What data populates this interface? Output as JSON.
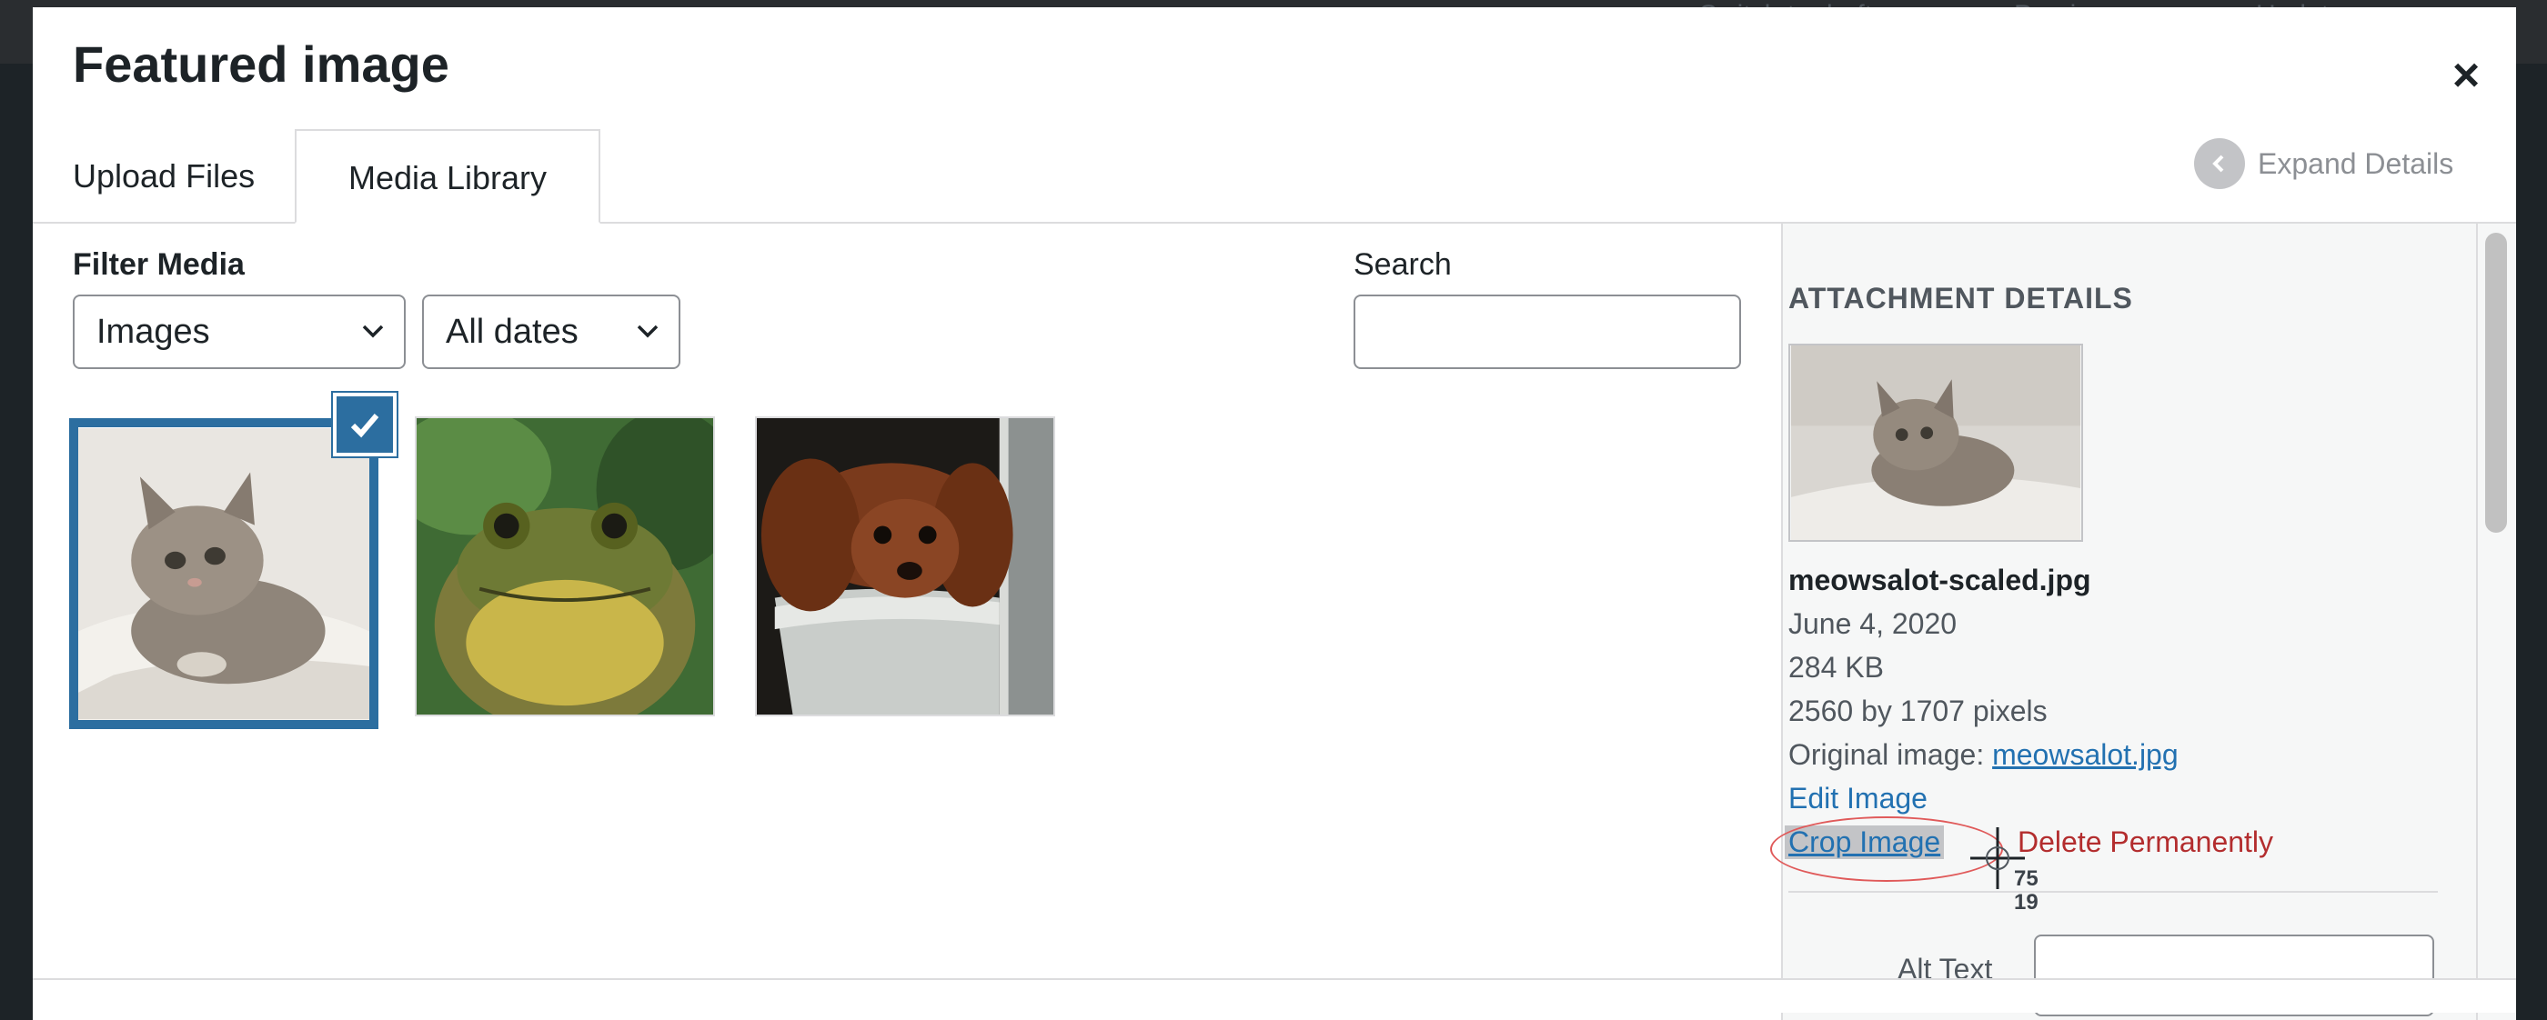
{
  "modal": {
    "title": "Featured image",
    "close_label": "×",
    "tabs": [
      {
        "label": "Upload Files"
      },
      {
        "label": "Media Library",
        "active": true
      }
    ],
    "expand_details": "Expand Details"
  },
  "background_toolbar": {
    "switch_to_draft": "Switch to draft",
    "preview": "Preview",
    "update": "Update"
  },
  "filters": {
    "label": "Filter Media",
    "type_select": {
      "value": "Images"
    },
    "date_select": {
      "value": "All dates"
    },
    "search_label": "Search",
    "search_value": ""
  },
  "media": [
    {
      "subject": "kitten",
      "selected": true
    },
    {
      "subject": "frog",
      "selected": false
    },
    {
      "subject": "dog",
      "selected": false
    }
  ],
  "attachment": {
    "heading": "ATTACHMENT DETAILS",
    "filename": "meowsalot-scaled.jpg",
    "date": "June 4, 2020",
    "size": "284 KB",
    "dimensions": "2560 by 1707 pixels",
    "original_label": "Original image:",
    "original_link": "meowsalot.jpg",
    "edit_image": "Edit Image",
    "crop_image": "Crop Image",
    "delete_permanently": "Delete Permanently",
    "alt_text_label": "Alt Text",
    "alt_text_value": ""
  },
  "cursor_readout": {
    "x": "75",
    "y": "19"
  },
  "colors": {
    "accent": "#2c6ea0",
    "link": "#2271b1",
    "delete": "#b32d2e",
    "sidebar_bg": "#f6f7f7"
  }
}
